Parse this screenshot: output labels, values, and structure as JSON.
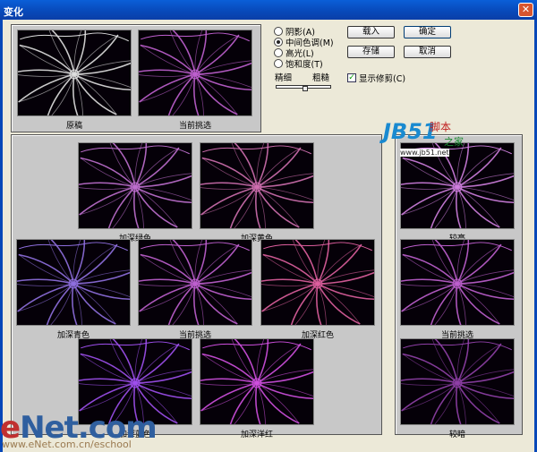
{
  "window": {
    "title": "变化",
    "close_icon": "close-icon"
  },
  "preview": {
    "original_label": "原稿",
    "current_label": "当前挑选"
  },
  "options": {
    "radios": [
      {
        "label": "阴影(A)",
        "selected": false
      },
      {
        "label": "中间色调(M)",
        "selected": true
      },
      {
        "label": "高光(L)",
        "selected": false
      },
      {
        "label": "饱和度(T)",
        "selected": false
      }
    ],
    "fine_label": "精细",
    "coarse_label": "粗糙",
    "slider_value": 0.5,
    "show_clipping_label": "显示修剪(C)",
    "show_clipping_checked": true
  },
  "buttons": {
    "load": "载入",
    "ok": "确定",
    "save": "存储",
    "cancel": "取消"
  },
  "variations": [
    {
      "label": "加深绿色",
      "tint": "#c070d0"
    },
    {
      "label": "加深黄色",
      "tint": "#d070b0"
    },
    {
      "label": "加深青色",
      "tint": "#9070e0"
    },
    {
      "label": "当前挑选",
      "tint": "#c060d0"
    },
    {
      "label": "加深红色",
      "tint": "#e060a0"
    },
    {
      "label": "加深蓝色",
      "tint": "#a050f0"
    },
    {
      "label": "加深洋红",
      "tint": "#d050e0"
    }
  ],
  "brightness": [
    {
      "label": "较亮",
      "tint": "#d080e0"
    },
    {
      "label": "当前挑选",
      "tint": "#c060d0"
    },
    {
      "label": "较暗",
      "tint": "#9040a8"
    }
  ],
  "original_tint": "#e0e0e0",
  "watermarks": {
    "jb51": "JB51",
    "jb51_a": "脚本",
    "jb51_b": "之家",
    "jb51_url": "www.jb51.net",
    "enet_e": "e",
    "enet": "Net.com",
    "enet_url": "www.eNet.com.cn/eschool"
  }
}
